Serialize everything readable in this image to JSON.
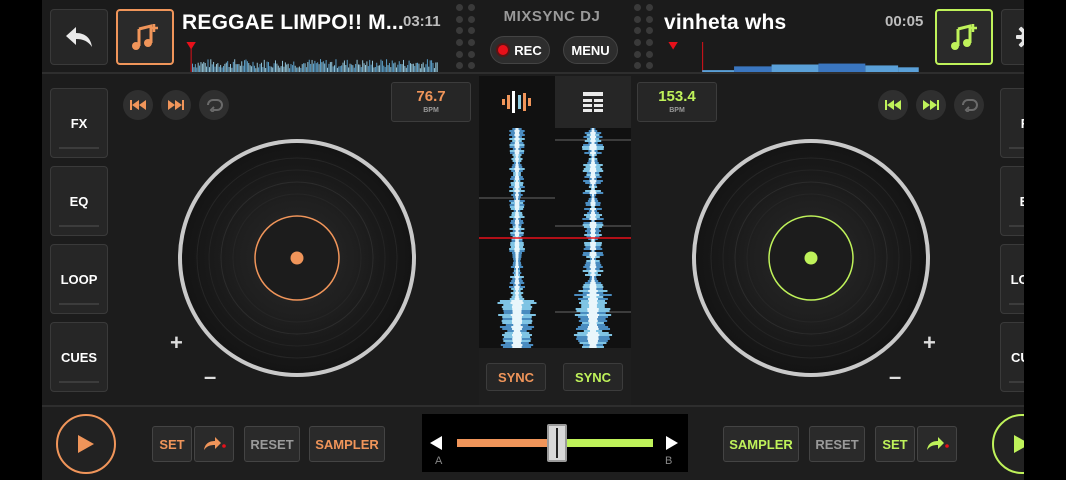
{
  "brand": "MIXSYNC DJ",
  "top": {
    "rec_label": "REC",
    "menu_label": "MENU"
  },
  "deck_a": {
    "title": "REGGAE LIMPO!! M...",
    "time": "03:11",
    "bpm": "76.7",
    "bpm_unit": "BPM",
    "accent": "#f0955a",
    "side_buttons": [
      "FX",
      "EQ",
      "LOOP",
      "CUES"
    ],
    "plus": "+",
    "minus": "–",
    "sync_label": "SYNC",
    "sampler_label": "SAMPLER",
    "reset_label": "RESET",
    "set_label": "SET"
  },
  "deck_b": {
    "title": "vinheta whs",
    "time": "00:05",
    "bpm": "153.4",
    "bpm_unit": "BPM",
    "accent": "#bff25a",
    "side_buttons": [
      "FX",
      "EQ",
      "LOOP",
      "CUES"
    ],
    "plus": "+",
    "minus": "–",
    "sync_label": "SYNC",
    "sampler_label": "SAMPLER",
    "reset_label": "RESET",
    "set_label": "SET"
  },
  "crossfader": {
    "label_a": "A",
    "label_b": "B",
    "position": 0.51
  },
  "icons": {
    "back": "back-arrow-icon",
    "add_music_a": "add-music-icon",
    "add_music_b": "add-music-icon",
    "settings": "gear-icon",
    "waveform_tab": "waveform-icon",
    "grid_tab": "grid-icon"
  }
}
